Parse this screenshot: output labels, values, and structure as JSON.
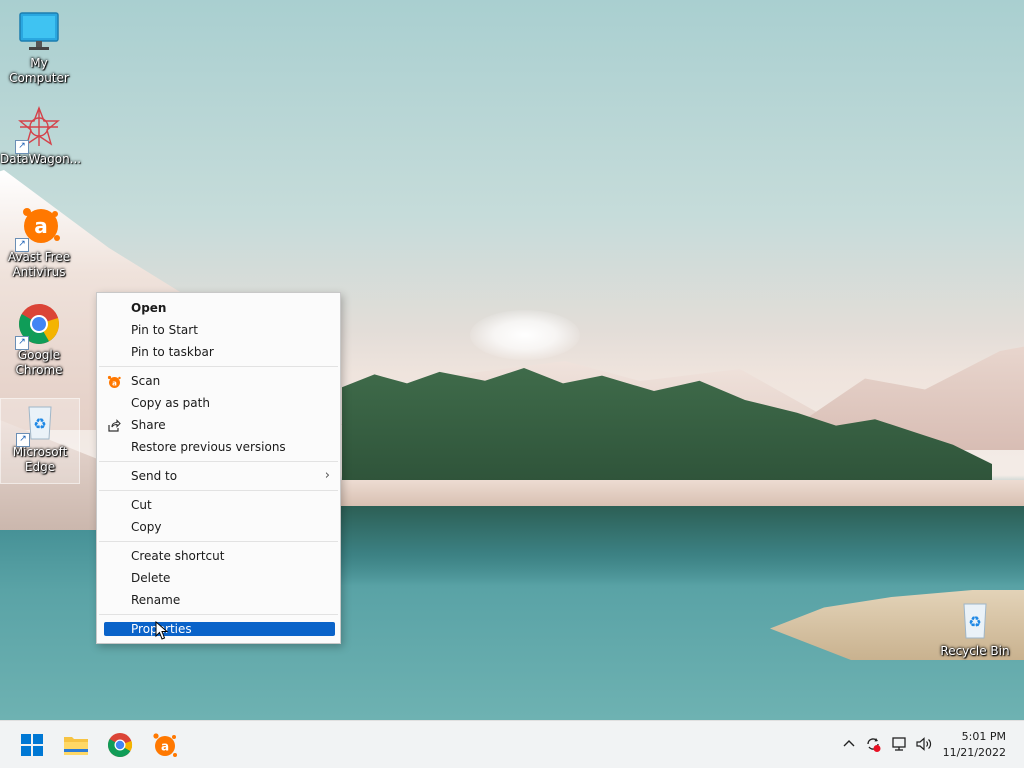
{
  "desktop_icons": [
    {
      "id": "my-computer",
      "label": "My Computer"
    },
    {
      "id": "datawagon",
      "label": "DataWagon..."
    },
    {
      "id": "avast",
      "label": "Avast Free Antivirus"
    },
    {
      "id": "chrome",
      "label": "Google Chrome"
    },
    {
      "id": "edge",
      "label": "Microsoft Edge"
    },
    {
      "id": "recycle-bin",
      "label": "Recycle Bin"
    }
  ],
  "context_menu": {
    "items": [
      {
        "label": "Open",
        "bold": true
      },
      {
        "label": "Pin to Start"
      },
      {
        "label": "Pin to taskbar"
      },
      {
        "label": "Scan",
        "icon": "avast-icon"
      },
      {
        "label": "Copy as path"
      },
      {
        "label": "Share",
        "icon": "share-icon"
      },
      {
        "label": "Restore previous versions"
      },
      {
        "label": "Send to",
        "submenu": true
      },
      {
        "label": "Cut"
      },
      {
        "label": "Copy"
      },
      {
        "label": "Create shortcut"
      },
      {
        "label": "Delete"
      },
      {
        "label": "Rename"
      },
      {
        "label": "Properties",
        "highlighted": true
      }
    ]
  },
  "taskbar": {
    "apps": [
      "windows-start-icon",
      "file-explorer-icon",
      "chrome-icon",
      "avast-icon"
    ],
    "tray": [
      "chevron-up-icon",
      "avast-update-icon",
      "network-icon",
      "volume-icon"
    ],
    "time": "5:01 PM",
    "date": "11/21/2022"
  },
  "colors": {
    "highlight": "#0a63c9",
    "avast_orange": "#ff7800",
    "menu_bg": "#fbfbfb",
    "taskbar_bg": "#f1f3f4"
  }
}
